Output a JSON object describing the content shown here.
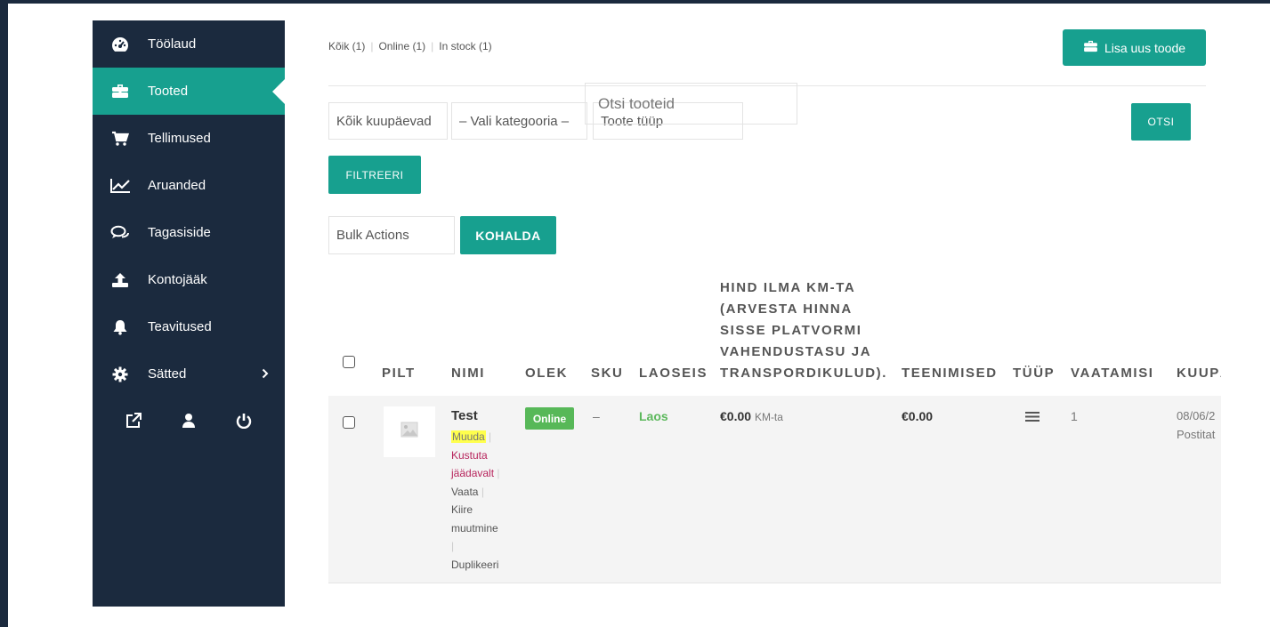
{
  "sidebar": {
    "items": [
      {
        "label": "Töölaud",
        "icon": "dashboard-icon",
        "active": false
      },
      {
        "label": "Tooted",
        "icon": "briefcase-icon",
        "active": true
      },
      {
        "label": "Tellimused",
        "icon": "cart-icon",
        "active": false
      },
      {
        "label": "Aruanded",
        "icon": "chart-line-icon",
        "active": false
      },
      {
        "label": "Tagasiside",
        "icon": "comments-icon",
        "active": false
      },
      {
        "label": "Kontojääk",
        "icon": "upload-icon",
        "active": false
      },
      {
        "label": "Teavitused",
        "icon": "bell-icon",
        "active": false
      },
      {
        "label": "Sätted",
        "icon": "gear-icon",
        "active": false
      }
    ],
    "footer_icons": [
      "external-link-icon",
      "user-icon",
      "power-icon"
    ]
  },
  "status_filters": {
    "all": "Kõik (1)",
    "online": "Online (1)",
    "in_stock": "In stock (1)"
  },
  "add_button": "Lisa uus toode",
  "filters": {
    "dates": "Kõik kuupäevad",
    "category": "– Vali kategooria –",
    "type": "Toote tüüp",
    "filter_button": "FILTREERI"
  },
  "search": {
    "placeholder": "Otsi tooteid",
    "button": "OTSI"
  },
  "bulk": {
    "select": "Bulk Actions",
    "apply": "KOHALDA"
  },
  "table": {
    "headers": {
      "image": "PILT",
      "name": "NIMI",
      "status": "OLEK",
      "sku": "SKU",
      "stock": "LAOSEIS",
      "price_lines": [
        "HIND ILMA KM-TA",
        "(ARVESTA HINNA",
        "SISSE PLATVORMI",
        "VAHENDUSTASU JA",
        "TRANSPORDIKULUD)."
      ],
      "earnings": "TEENIMISED",
      "type": "TÜÜP",
      "views": "VAATAMISI",
      "date": "KUUPÄ"
    },
    "rows": [
      {
        "name": "Test",
        "status": "Online",
        "sku": "–",
        "stock": "Laos",
        "price": "€0.00",
        "price_suffix": "KM-ta",
        "earnings": "€0.00",
        "views": "1",
        "date": "08/06/2",
        "date_status": "Postitat",
        "actions": {
          "edit": "Muuda",
          "delete_1": "Kustuta",
          "delete_2": "jäädavalt",
          "view": "Vaata",
          "quick_1": "Kiire",
          "quick_2": "muutmine",
          "duplicate": "Duplikeeri"
        }
      }
    ]
  },
  "colors": {
    "sidebar_bg": "#1b2a3e",
    "accent": "#17a08f",
    "online_badge": "#57b858",
    "stock_text": "#5cb85c",
    "delete_link": "#b7245c",
    "highlight": "#ffff4d"
  }
}
